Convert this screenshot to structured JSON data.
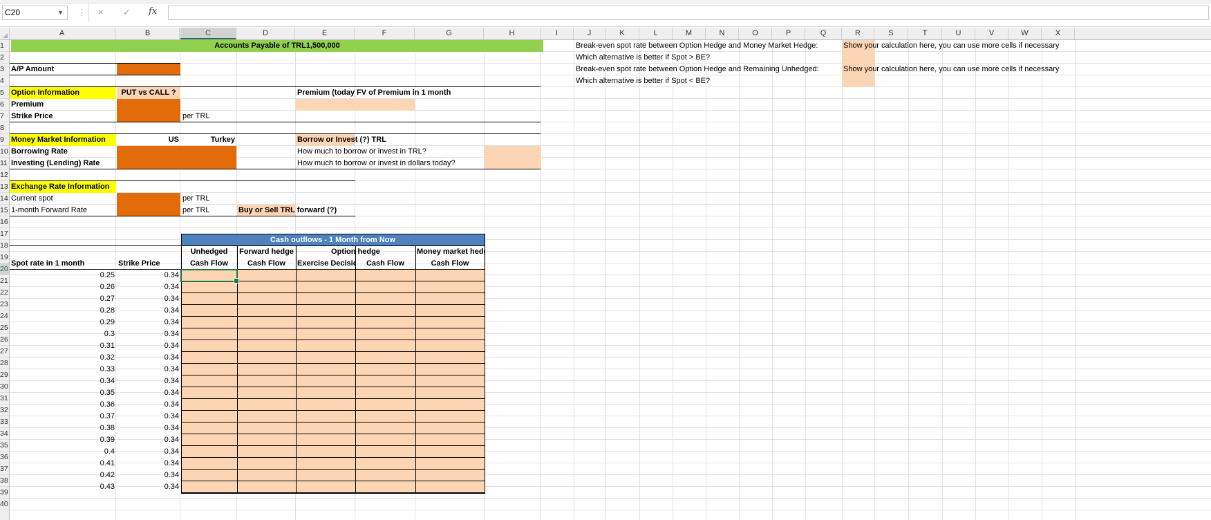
{
  "formula_bar": {
    "name_box": "C20",
    "formula": "",
    "fx_label": "fx",
    "cancel_icon": "×",
    "enter_icon": "✓"
  },
  "columns": [
    "A",
    "B",
    "C",
    "D",
    "E",
    "F",
    "G",
    "H",
    "I",
    "J",
    "K",
    "L",
    "M",
    "N",
    "O",
    "P",
    "Q",
    "R",
    "S",
    "T",
    "U",
    "V",
    "W",
    "X"
  ],
  "selected_column": "C",
  "rows": [
    "1",
    "2",
    "3",
    "4",
    "5",
    "6",
    "7",
    "8",
    "9",
    "10",
    "11",
    "12",
    "13",
    "14",
    "15",
    "16",
    "17",
    "18",
    "19",
    "20",
    "21",
    "22",
    "23",
    "24",
    "25",
    "26",
    "27",
    "28",
    "29",
    "30",
    "31",
    "32",
    "33",
    "34",
    "35",
    "36",
    "37",
    "38",
    "39",
    "40"
  ],
  "selected_row": "20",
  "sheet": {
    "title": "Accounts Payable of TRL1,500,000",
    "ap_amount": "A/P Amount",
    "option_info": "Option Information",
    "put_vs_call": "PUT vs CALL ?",
    "premium_today": "Premium (today)",
    "fv_premium": "FV of Premium in 1 month",
    "premium": "Premium",
    "strike_price": "Strike Price",
    "per_trl": "per TRL",
    "money_market_info": "Money Market Information",
    "us": "US",
    "turkey": "Turkey",
    "borrow_or_invest": "Borrow or Invest (?) TRL",
    "borrowing_rate": "Borrowing Rate",
    "investing_rate": "Investing (Lending) Rate",
    "how_much_trl": "How much to borrow or invest in TRL?",
    "how_much_usd": "How much to borrow or invest in dollars today?",
    "exchange_rate_info": "Exchange Rate Information",
    "current_spot": "Current spot",
    "forward_rate": "1-month Forward Rate",
    "buy_or_sell": "Buy or Sell TRL forward (?)",
    "cashflows_title": "Cash outflows - 1 Month from Now",
    "unhedged": "Unhedged",
    "forward_hedge": "Forward hedge",
    "option_hedge": "Option hedge",
    "money_market_hedge": "Money market hedge",
    "cash_flow": "Cash Flow",
    "exercise_decision": "Exercise Decision",
    "spot_rate_1m": "Spot rate in 1 month",
    "strike_price_col": "Strike Price",
    "be_mm": "Break-even spot rate between Option Hedge and Money Market Hedge:",
    "which_gt": "Which alternative is better if Spot > BE?",
    "be_unhedged": "Break-even spot rate between Option Hedge and Remaining Unhedged:",
    "which_lt": "Which alternative is better if Spot < BE?",
    "show_calc_1": "Show your calculation here, you can use more cells if necessary",
    "show_calc_2": "Show your calculation here, you can use more cells if necessary"
  },
  "table": {
    "spot": [
      "0.25",
      "0.26",
      "0.27",
      "0.28",
      "0.29",
      "0.3",
      "0.31",
      "0.32",
      "0.33",
      "0.34",
      "0.35",
      "0.36",
      "0.37",
      "0.38",
      "0.39",
      "0.4",
      "0.41",
      "0.42",
      "0.43"
    ],
    "strike": [
      "0.34",
      "0.34",
      "0.34",
      "0.34",
      "0.34",
      "0.34",
      "0.34",
      "0.34",
      "0.34",
      "0.34",
      "0.34",
      "0.34",
      "0.34",
      "0.34",
      "0.34",
      "0.34",
      "0.34",
      "0.34",
      "0.34"
    ]
  },
  "colors": {
    "orange": "#e26b0a",
    "peach": "#fcd5b4",
    "yellow": "#ffff00",
    "green": "#92d050",
    "blue": "#4f81bd",
    "excel_green": "#217346"
  }
}
